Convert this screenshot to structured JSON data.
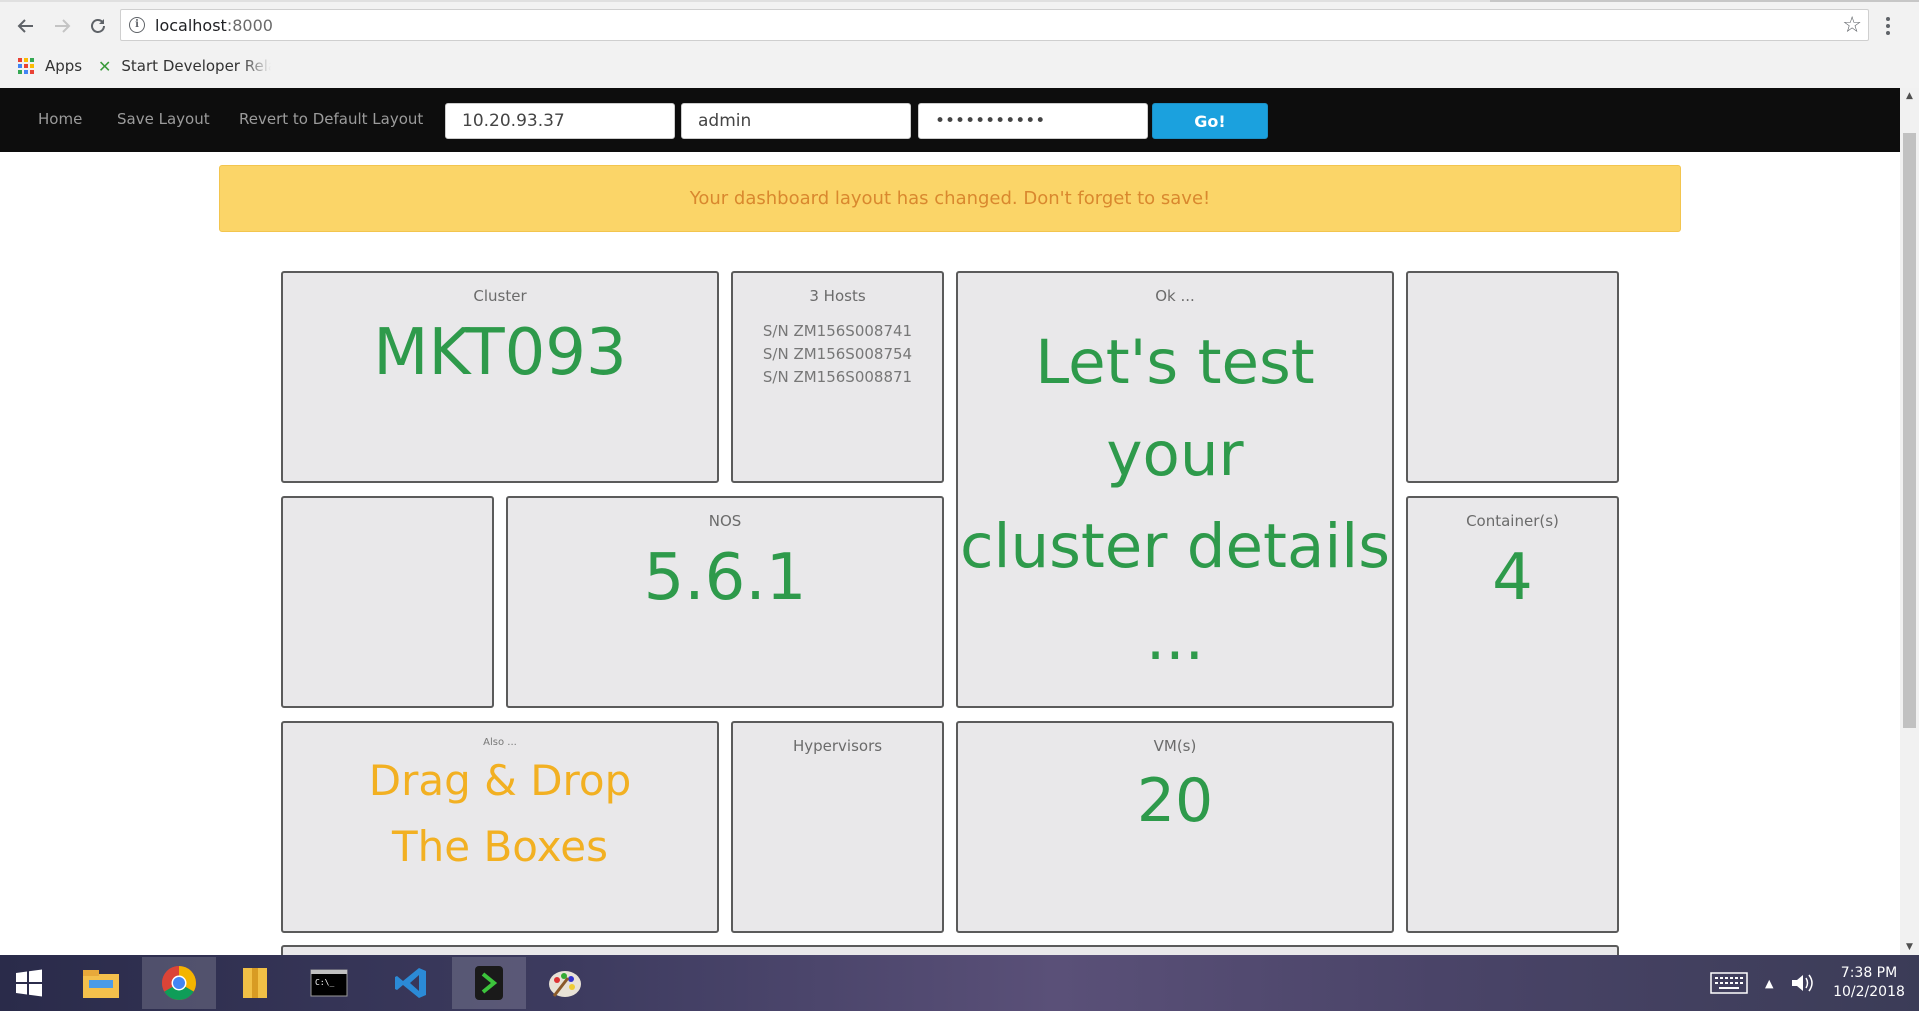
{
  "browser": {
    "url_host": "localhost",
    "url_port": ":8000",
    "bookmarks": {
      "apps_label": "Apps",
      "item1_label": "Start Developer Relat"
    }
  },
  "navbar": {
    "links": {
      "home": "Home",
      "save_layout": "Save Layout",
      "revert": "Revert to Default Layout"
    },
    "ip_value": "10.20.93.37",
    "user_value": "admin",
    "password_value": "•••••••••••",
    "go_label": "Go!"
  },
  "alert": {
    "message": "Your dashboard layout has changed. Don't forget to save!"
  },
  "tiles": {
    "cluster": {
      "title": "Cluster",
      "value": "MKT093"
    },
    "hosts": {
      "title": "3 Hosts",
      "serials": [
        "S/N ZM156S008741",
        "S/N ZM156S008754",
        "S/N ZM156S008871"
      ]
    },
    "ok": {
      "title": "Ok ...",
      "line1": "Let's test your",
      "line2": "cluster details",
      "line3": "..."
    },
    "nos": {
      "title": "NOS",
      "value": "5.6.1"
    },
    "containers": {
      "title": "Container(s)",
      "value": "4"
    },
    "also": {
      "title": "Also ...",
      "line1": "Drag & Drop",
      "line2": "The Boxes"
    },
    "hypervisors": {
      "title": "Hypervisors"
    },
    "vms": {
      "title": "VM(s)",
      "value": "20"
    }
  },
  "taskbar": {
    "clock_time": "7:38 PM",
    "clock_date": "10/2/2018",
    "items": [
      "start-icon",
      "file-explorer-icon",
      "chrome-icon",
      "archive-folder-icon",
      "command-prompt-icon",
      "vscode-icon",
      "green-terminal-icon",
      "paint-icon"
    ]
  },
  "colors": {
    "navbar_bg": "#0d0d0d",
    "alert_bg": "#fbd568",
    "alert_text": "#d9882e",
    "tile_bg": "#e9e8ea",
    "value_green": "#2e9a4b",
    "value_orange": "#f2b022",
    "go_button": "#1ba1de"
  }
}
